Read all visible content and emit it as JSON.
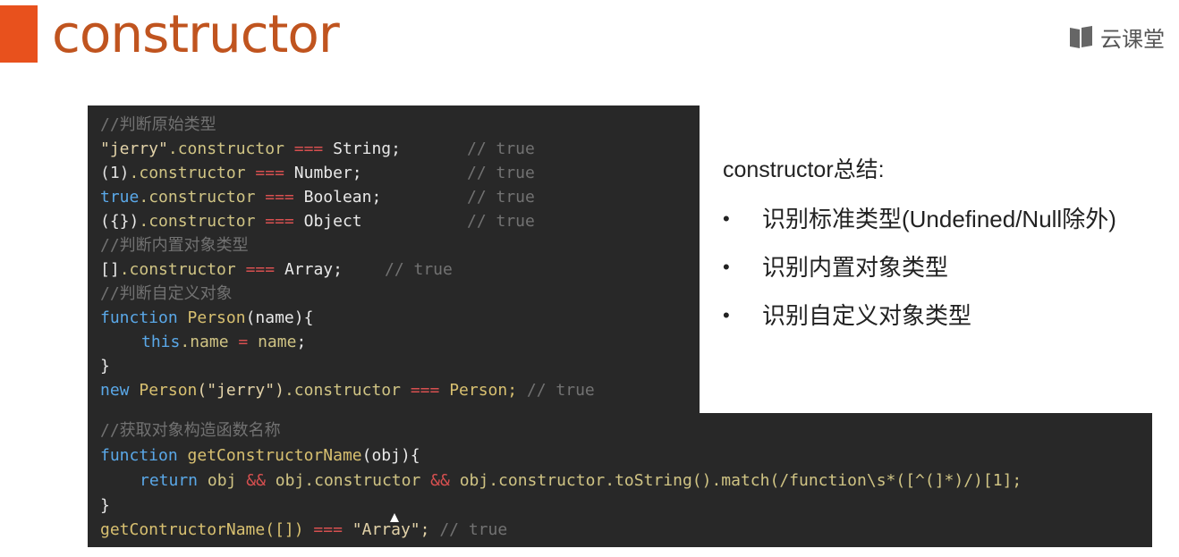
{
  "header": {
    "title": "constructor",
    "brand": "云课堂",
    "brand_icon": "book-icon",
    "accent_color": "#e8511d"
  },
  "code_block_1": {
    "comment_primitive": "//判断原始类型",
    "l1": {
      "a": "\"jerry\"",
      "b": ".constructor",
      "c": "===",
      "d": "String;",
      "e": "// true"
    },
    "l2": {
      "a": "(1)",
      "b": ".constructor",
      "c": "===",
      "d": "Number;",
      "e": "// true"
    },
    "l3": {
      "a": "true",
      "b": ".constructor",
      "c": "===",
      "d": "Boolean;",
      "e": "// true"
    },
    "l4": {
      "a": "({})",
      "b": ".constructor",
      "c": "===",
      "d": "Object",
      "e": "// true"
    },
    "comment_builtin": "//判断内置对象类型",
    "l5": {
      "a": "[]",
      "b": ".constructor",
      "c": "===",
      "d": "Array;",
      "e": "// true"
    },
    "comment_custom": "//判断自定义对象",
    "l6": {
      "a": "function",
      "b": "Person",
      "c": "(name){"
    },
    "l7": {
      "a": "this",
      "b": ".name",
      "c": "=",
      "d": "name",
      "e": ";"
    },
    "l8": "}",
    "l9": {
      "a": "new",
      "b": "Person",
      "c": "(\"jerry\")",
      "d": ".constructor",
      "e": "===",
      "f": "Person;",
      "g": "// true"
    }
  },
  "code_block_2": {
    "comment": "//获取对象构造函数名称",
    "l1": {
      "a": "function",
      "b": "getConstructorName",
      "c": "(obj){"
    },
    "l2": {
      "a": "return",
      "b": "obj",
      "c": "&&",
      "d": "obj.constructor",
      "e": "&&",
      "f": "obj.constructor.toString().match(/function\\s*([^(]*)/)[1];"
    },
    "l3": "}",
    "l4": {
      "a": "getContructorName([])",
      "b": "===",
      "c": "\"Array\";",
      "d": "// true"
    }
  },
  "summary": {
    "title": "constructor总结:",
    "items": [
      "识别标准类型(Undefined/Null除外)",
      "识别内置对象类型",
      "识别自定义对象类型"
    ]
  }
}
